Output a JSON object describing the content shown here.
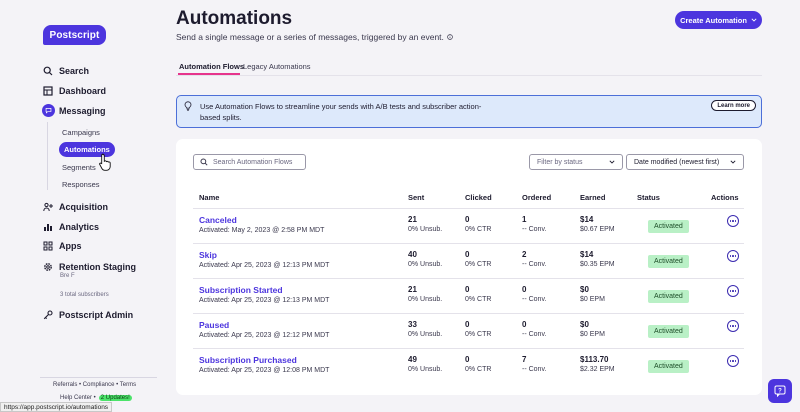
{
  "sidebar": {
    "logo": "Postscript",
    "nav": {
      "search": "Search",
      "dashboard": "Dashboard",
      "messaging": "Messaging",
      "acquisition": "Acquisition",
      "analytics": "Analytics",
      "apps": "Apps",
      "retention": "Retention Staging",
      "postscript_admin": "Postscript Admin"
    },
    "messaging_sub": {
      "campaigns": "Campaigns",
      "automations": "Automations",
      "segments": "Segments",
      "responses": "Responses"
    },
    "user_initials": "Bre F",
    "subscriber_count": "3 total subscribers",
    "footer": {
      "links": "Referrals  •  Compliance  •  Terms",
      "help_center": "Help Center  •",
      "updates_badge": "2 Updates!"
    },
    "status_url": "https://app.postscript.io/automations"
  },
  "header": {
    "title": "Automations",
    "subtitle": "Send a single message or a series of messages, triggered by an event.",
    "create_button": "Create Automation"
  },
  "tabs": [
    {
      "label": "Automation Flows",
      "active": true
    },
    {
      "label": "Legacy Automations",
      "active": false
    }
  ],
  "banner": {
    "text": "Use Automation Flows to streamline your sends with A/B tests and subscriber action-based splits.",
    "learn_more": "Learn more"
  },
  "filters": {
    "search_placeholder": "Search Automation Flows",
    "status_placeholder": "Filter by status",
    "sort_value": "Date modified (newest first)"
  },
  "table": {
    "headers": {
      "name": "Name",
      "sent": "Sent",
      "clicked": "Clicked",
      "ordered": "Ordered",
      "earned": "Earned",
      "status": "Status",
      "actions": "Actions"
    },
    "rows": [
      {
        "name": "Canceled",
        "activated": "Activated: May 2, 2023 @ 2:58 PM MDT",
        "sent": "21",
        "unsub": "0% Unsub.",
        "clicked": "0",
        "ctr": "0% CTR",
        "ordered": "1",
        "conv": "-- Conv.",
        "earned": "$14",
        "epm": "$0.67 EPM",
        "status": "Activated"
      },
      {
        "name": "Skip",
        "activated": "Activated: Apr 25, 2023 @ 12:13 PM MDT",
        "sent": "40",
        "unsub": "0% Unsub.",
        "clicked": "0",
        "ctr": "0% CTR",
        "ordered": "2",
        "conv": "-- Conv.",
        "earned": "$14",
        "epm": "$0.35 EPM",
        "status": "Activated"
      },
      {
        "name": "Subscription Started",
        "activated": "Activated: Apr 25, 2023 @ 12:13 PM MDT",
        "sent": "21",
        "unsub": "0% Unsub.",
        "clicked": "0",
        "ctr": "0% CTR",
        "ordered": "0",
        "conv": "-- Conv.",
        "earned": "$0",
        "epm": "$0 EPM",
        "status": "Activated"
      },
      {
        "name": "Paused",
        "activated": "Activated: Apr 25, 2023 @ 12:12 PM MDT",
        "sent": "33",
        "unsub": "0% Unsub.",
        "clicked": "0",
        "ctr": "0% CTR",
        "ordered": "0",
        "conv": "-- Conv.",
        "earned": "$0",
        "epm": "$0 EPM",
        "status": "Activated"
      },
      {
        "name": "Subscription Purchased",
        "activated": "Activated: Apr 25, 2023 @ 12:08 PM MDT",
        "sent": "49",
        "unsub": "0% Unsub.",
        "clicked": "0",
        "ctr": "0% CTR",
        "ordered": "7",
        "conv": "-- Conv.",
        "earned": "$113.70",
        "epm": "$2.32 EPM",
        "status": "Activated"
      }
    ]
  },
  "colors": {
    "brand": "#4c35de",
    "tab_underline": "#e6348c",
    "status_green": "#b9f0c6",
    "banner_bg": "#dde9fb"
  }
}
